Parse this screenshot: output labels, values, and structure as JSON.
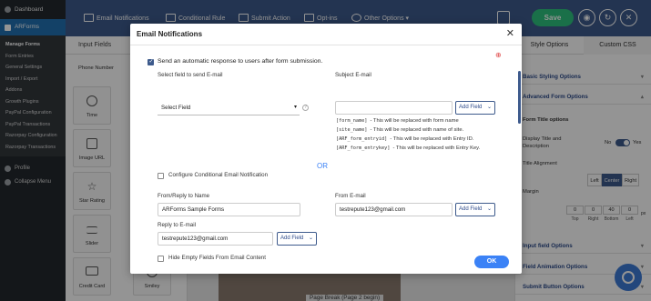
{
  "wp_sidebar": {
    "dashboard": "Dashboard",
    "arforms": "ARForms",
    "submenu": [
      "Manage Forms",
      "Form Entries",
      "General Settings",
      "Import / Export",
      "Addons",
      "Growth Plugins",
      "PayPal Configuration",
      "PayPal Transactions",
      "Razorpay Configuration",
      "Razorpay Transactions"
    ],
    "profile": "Profile",
    "collapse": "Collapse Menu"
  },
  "toolbar": {
    "email_notifications": "Email Notifications",
    "conditional_rule": "Conditional Rule",
    "submit_action": "Submit Action",
    "optins": "Opt-ins",
    "other_options": "Other Options",
    "save": "Save",
    "accent": "#3d5a8c"
  },
  "fields_panel": {
    "title": "Input Fields",
    "phone_number": "Phone Number",
    "items": [
      "Time",
      "Image URL",
      "Star Rating",
      "Slider",
      "Credit Card",
      "Smiley"
    ]
  },
  "canvas": {
    "page_break": "Page Break (Page 2 begin)"
  },
  "right_panel": {
    "tab_style": "Style Options",
    "tab_css": "Custom CSS",
    "basic_styling": "Basic Styling Options",
    "advanced_form": "Advanced Form Options",
    "form_title_options": "Form Title options",
    "display_title": "Display Title and Description",
    "no": "No",
    "yes": "Yes",
    "title_alignment": "Title Alignment",
    "align_left": "Left",
    "align_center": "Center",
    "align_right": "Right",
    "margin": "Margin",
    "margin_values": [
      "0",
      "0",
      "40",
      "0"
    ],
    "margin_labels": [
      "Top",
      "Right",
      "Bottom",
      "Left"
    ],
    "margin_unit": "px",
    "input_field_options": "Input field Options",
    "field_animation": "Field Animation Options",
    "submit_button": "Submit Button Options"
  },
  "modal": {
    "title": "Email Notifications",
    "send_auto": "Send an automatic response to users after form submission.",
    "select_field_label": "Select field to send E-mail",
    "select_field_value": "Select Field",
    "subject_label": "Subject E-mail",
    "add_field": "Add Field",
    "shortcodes": [
      {
        "code": "[form_name]",
        "desc": "- This will be replaced with form name"
      },
      {
        "code": "[site_name]",
        "desc": "- This will be replaced with name of site."
      },
      {
        "code": "[ARF_form_entryid]",
        "desc": "- This will be replaced with Entry ID."
      },
      {
        "code": "[ARF_form_entrykey]",
        "desc": "- This will be replaced with Entry Key."
      }
    ],
    "conditional_email": "Configure Conditional Email Notification",
    "or": "OR",
    "from_reply_label": "From/Reply to Name",
    "from_reply_value": "ARForms Sample Forms",
    "from_email_label": "From E-mail",
    "from_email_value": "testrepute123@gmail.com",
    "reply_to_label": "Reply to E-mail",
    "reply_to_value": "testrepute123@gmail.com",
    "hide_empty": "Hide Empty Fields From Email Content",
    "ok": "OK"
  }
}
